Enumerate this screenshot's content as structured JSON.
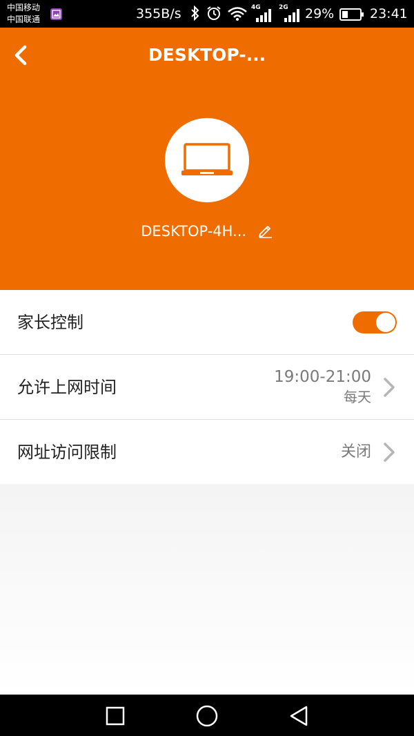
{
  "status_bar": {
    "carrier_1": "中国移动",
    "carrier_2": "中国联通",
    "net_speed": "355B/s",
    "net_tag_1": "4G",
    "net_tag_2": "2G",
    "battery": "29%",
    "time": "23:41"
  },
  "header": {
    "title": "DESKTOP-...",
    "device_name": "DESKTOP-4H...",
    "background_color": "#ef6c00"
  },
  "settings": {
    "parental_control": {
      "label": "家长控制",
      "enabled": true
    },
    "online_time": {
      "label": "允许上网时间",
      "time_range": "19:00-21:00",
      "repeat": "每天"
    },
    "url_restriction": {
      "label": "网址访问限制",
      "value": "关闭"
    }
  },
  "icons": {
    "back": "chevron-left-icon",
    "device": "laptop-icon",
    "edit": "pencil-icon",
    "row_arrow": "chevron-right-icon",
    "nav_recent": "square-icon",
    "nav_home": "circle-icon",
    "nav_back": "triangle-icon"
  }
}
